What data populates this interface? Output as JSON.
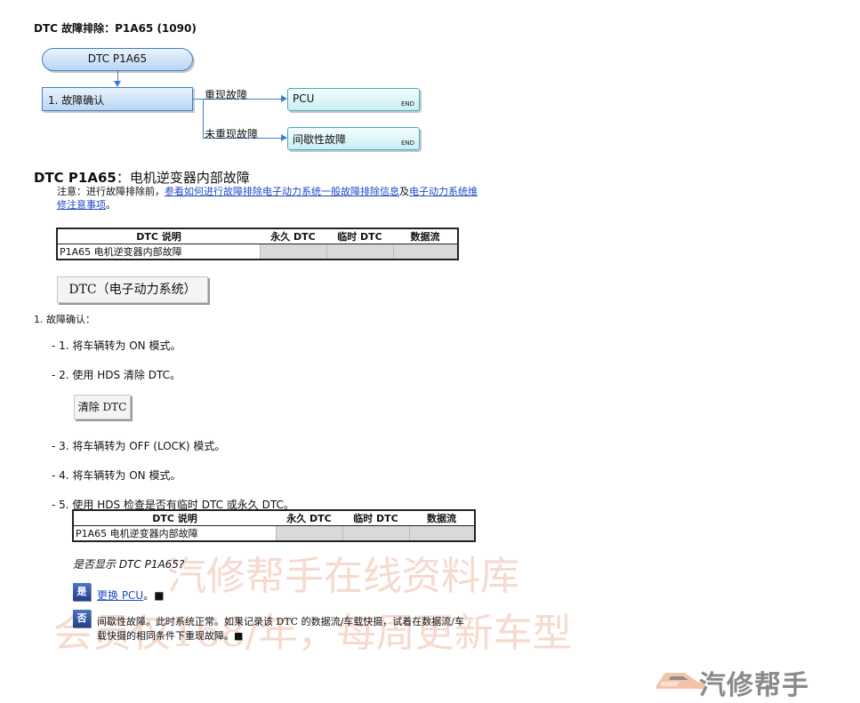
{
  "header": {
    "title": "DTC 故障排除：P1A65 (1090)"
  },
  "flowchart": {
    "start": "DTC P1A65",
    "step1": "1.  故障确认",
    "branch_yes": "重现故障",
    "branch_no": "未重现故障",
    "end_pcu": "PCU",
    "end_intermittent": "间歇性故障",
    "end_label": "END"
  },
  "section": {
    "title_code": "DTC P1A65",
    "title_colon": "：",
    "title_desc": "电机逆变器内部故障",
    "note_prefix": "注意：进行故障排除前，",
    "note_link1": "参看如何进行故障排除电子动力系统一般故障排除信息",
    "note_mid": "及",
    "note_link2a": "电子动力系统维",
    "note_link2b": "修注意事项",
    "note_suffix": "。"
  },
  "dtc_table": {
    "headers": [
      "DTC 说明",
      "永久 DTC",
      "临时 DTC",
      "数据流"
    ],
    "row": "P1A65 电机逆变器内部故障"
  },
  "dtc_button": "DTC（电子动力系统）",
  "procedure": {
    "step1_title": "1.  故障确认：",
    "sub1": "- 1. 将车辆转为 ON 模式。",
    "sub2": "- 2. 使用 HDS 清除 DTC。",
    "clear_button": "清除 DTC",
    "sub3": "- 3. 将车辆转为 OFF (LOCK) 模式。",
    "sub4": "- 4. 将车辆转为 ON 模式。",
    "sub5": "- 5. 使用 HDS 检查是否有临时 DTC 或永久 DTC。"
  },
  "question": "是否显示 DTC P1A65?",
  "answers": {
    "yes_icon": "是",
    "yes_link": "更换 PCU",
    "yes_suffix": "。■",
    "no_icon": "否",
    "no_line1": "间歇性故障。此时系统正常。如果记录该 DTC 的数据流/车载快摄，试着在数据流/车",
    "no_line2": "载快摄的相同条件下重现故障。■"
  },
  "watermark": {
    "line1": "汽修帮手在线资料库",
    "line2": "会员仅168/年，每周更新车型",
    "logo_text": "汽修帮手"
  },
  "colors": {
    "link": "#1f49c8",
    "flow_border": "#3f7fc9",
    "end_border": "#3fb0b8",
    "watermark": "#f6d9cf"
  }
}
